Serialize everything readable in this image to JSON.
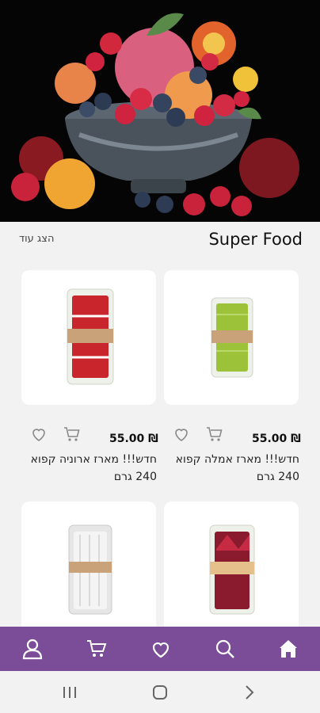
{
  "section": {
    "title": "Super Food",
    "show_more": "הצג עוד"
  },
  "products": [
    {
      "price": "55.00 ₪",
      "name": "חדש!!! מארז אמלה קפוא 240 גרם",
      "pack_color": "#9cc23a"
    },
    {
      "price": "55.00 ₪",
      "name": "חדש!!! מארז ארוניה קפוא 240 גרם",
      "pack_color": "#c9252c"
    },
    {
      "pack_color": "#8a1b2e"
    },
    {
      "pack_color": "#f4f4f4"
    }
  ],
  "colors": {
    "nav_bg": "#7b4c97",
    "nav_icon": "#ffffff",
    "accent": "#7b4c97"
  },
  "bottom_nav": [
    "home-icon",
    "search-icon",
    "heart-icon",
    "cart-icon",
    "user-icon"
  ],
  "system_nav": [
    "back-icon",
    "home-circle-icon",
    "recent-apps-icon"
  ]
}
